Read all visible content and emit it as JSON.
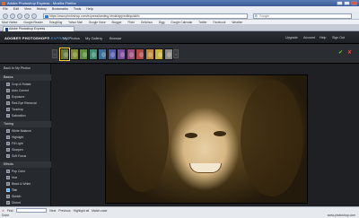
{
  "browser": {
    "title": "Adobe Photoshop Express - Mozilla Firefox",
    "menu": [
      "File",
      "Edit",
      "View",
      "History",
      "Bookmarks",
      "Tools",
      "Help"
    ],
    "url": "https://www.photoshop.com/express/landing.html#/app/edit/quickfix",
    "search_engine": "G",
    "search_placeholder": "Google",
    "bookmarks": [
      "Most Visited",
      "Google Reader",
      "SmugMug",
      "Yahoo Mail",
      "Google Voice",
      "Blogger",
      "Flickr",
      "Delicious",
      "Digg",
      "Google Calendar",
      "Twitter",
      "Facebook",
      "Weather"
    ],
    "tab": "Adobe Photoshop Express"
  },
  "app": {
    "logo": "ADOBE® PHOTOSHOP®",
    "logo_suffix": "EXPRESS",
    "nav": [
      "My Photos",
      "My Gallery",
      "Browse"
    ],
    "top_links": [
      "Upgrade",
      "Account",
      "Help",
      "Sign Out"
    ],
    "thumbnail_colors": [
      "#6b7d3c",
      "#7f8a2e",
      "#5d8c3c",
      "#3f8c74",
      "#3b6f98",
      "#4d5aa2",
      "#7a4d9a",
      "#9a4d7e",
      "#b04848",
      "#c48a3c",
      "#c9b33c",
      "#8b8b8b"
    ],
    "film_prev": "‹",
    "film_next": "›",
    "ok_icon": "✔",
    "cancel_icon": "✘"
  },
  "sidebar": {
    "back": "Back to My Photos",
    "sections": [
      {
        "title": "Basics",
        "items": [
          {
            "label": "Crop & Rotate",
            "icon": "crop-icon"
          },
          {
            "label": "Auto Correct",
            "icon": "wand-icon"
          },
          {
            "label": "Exposure",
            "icon": "exposure-icon"
          },
          {
            "label": "Red-Eye Removal",
            "icon": "eye-icon"
          },
          {
            "label": "Touchup",
            "icon": "brush-icon"
          },
          {
            "label": "Saturation",
            "icon": "saturation-icon"
          }
        ]
      },
      {
        "title": "Tuning",
        "items": [
          {
            "label": "White Balance",
            "icon": "balance-icon"
          },
          {
            "label": "Highlight",
            "icon": "highlight-icon"
          },
          {
            "label": "Fill Light",
            "icon": "light-icon"
          },
          {
            "label": "Sharpen",
            "icon": "sharpen-icon"
          },
          {
            "label": "Soft Focus",
            "icon": "focus-icon"
          }
        ]
      },
      {
        "title": "Effects",
        "items": [
          {
            "label": "Pop Color",
            "icon": "pop-color-icon"
          },
          {
            "label": "Hue",
            "icon": "hue-icon"
          },
          {
            "label": "Black & White",
            "icon": "bw-icon"
          },
          {
            "label": "Tint",
            "icon": "tint-icon",
            "active": true
          },
          {
            "label": "Sketch",
            "icon": "sketch-icon"
          },
          {
            "label": "Distort",
            "icon": "distort-icon"
          }
        ]
      }
    ]
  },
  "statusbar": {
    "find_label": "Find:",
    "find_next": "Next",
    "find_prev": "Previous",
    "highlight": "Highlight all",
    "match_case": "Match case",
    "status": "Done",
    "right": "www.photoshop.com"
  }
}
